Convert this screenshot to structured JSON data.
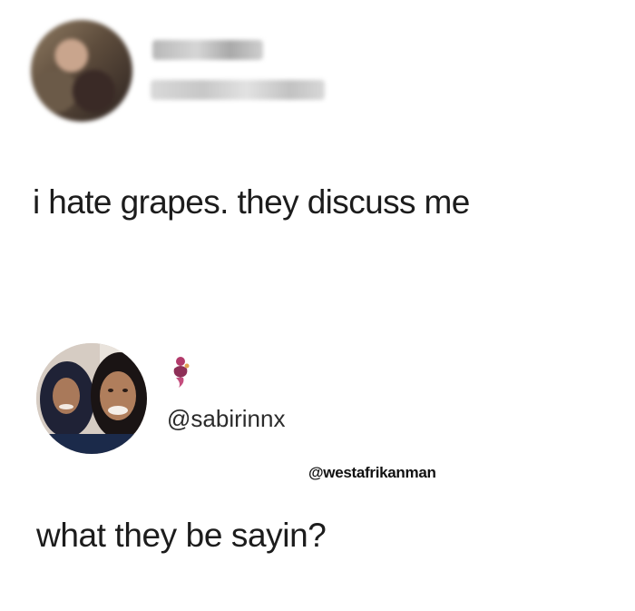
{
  "post": {
    "avatar_icon": "blurred-profile-photo",
    "text": "i hate grapes. they discuss me"
  },
  "reply": {
    "avatar_icon": "profile-photo-two-women",
    "emoji_icon": "genie-emoji",
    "handle": "@sabirinnx",
    "text": "what they be sayin?"
  },
  "watermark": {
    "text": "@westafrikanman"
  },
  "colors": {
    "background": "#ffffff",
    "text": "#1c1c1c"
  }
}
